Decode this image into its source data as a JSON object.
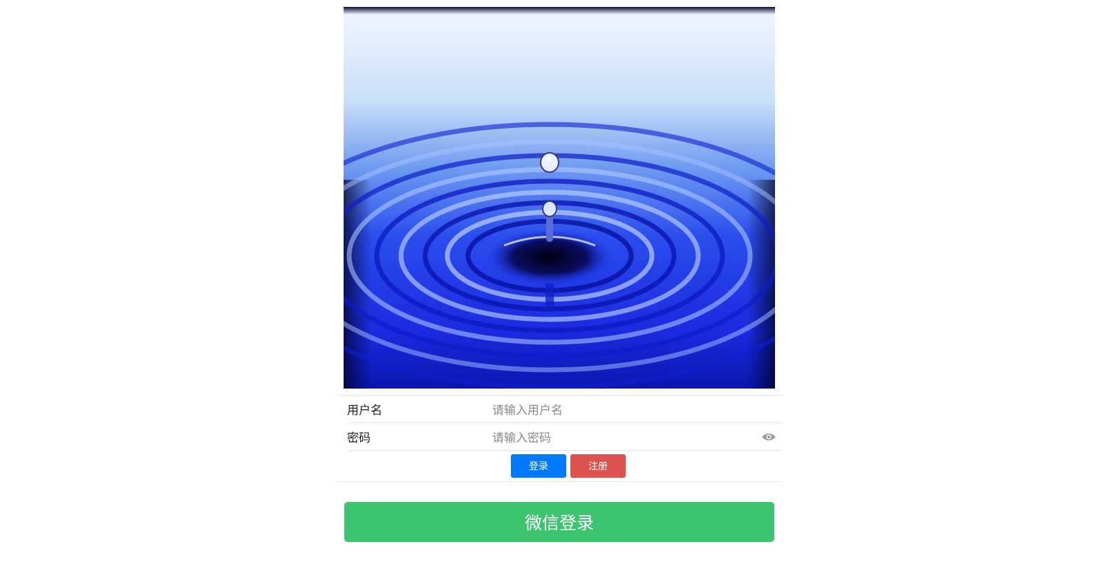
{
  "hero": {
    "alt": "water-drop-ripple-image"
  },
  "form": {
    "username": {
      "label": "用户名",
      "placeholder": "请输入用户名"
    },
    "password": {
      "label": "密码",
      "placeholder": "请输入密码",
      "toggle_icon": "eye-icon"
    },
    "buttons": {
      "login": "登录",
      "register": "注册"
    }
  },
  "wechat_login": {
    "label": "微信登录"
  },
  "colors": {
    "login_blue": "#007aff",
    "register_red": "#dd524d",
    "wechat_green": "#3cc46f"
  }
}
